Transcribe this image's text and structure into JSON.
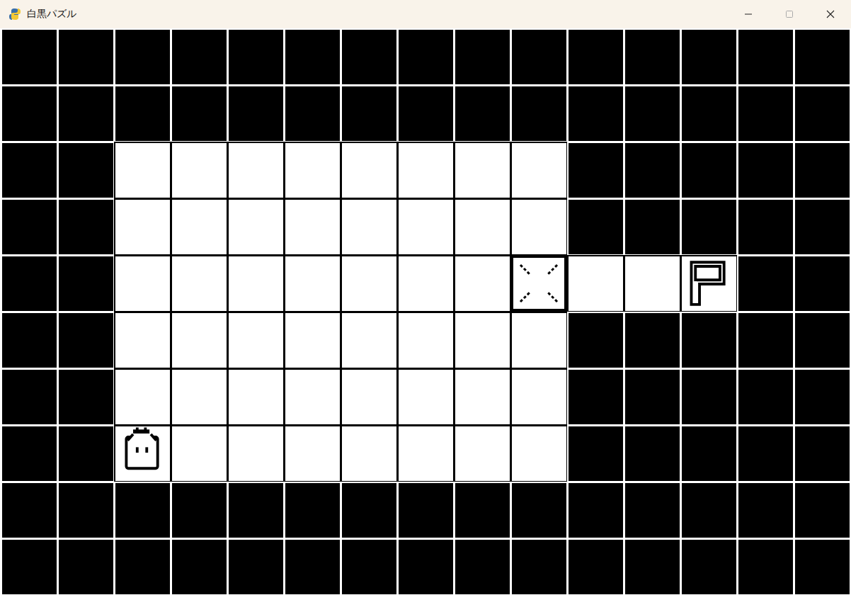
{
  "window": {
    "title": "白黒パズル"
  },
  "board": {
    "rows": [
      "###############",
      "###############",
      "##........#####",
      "##........#####",
      "##.......X..F##",
      "##........#####",
      "##........#####",
      "##P.......#####",
      "###############",
      "###############"
    ]
  }
}
